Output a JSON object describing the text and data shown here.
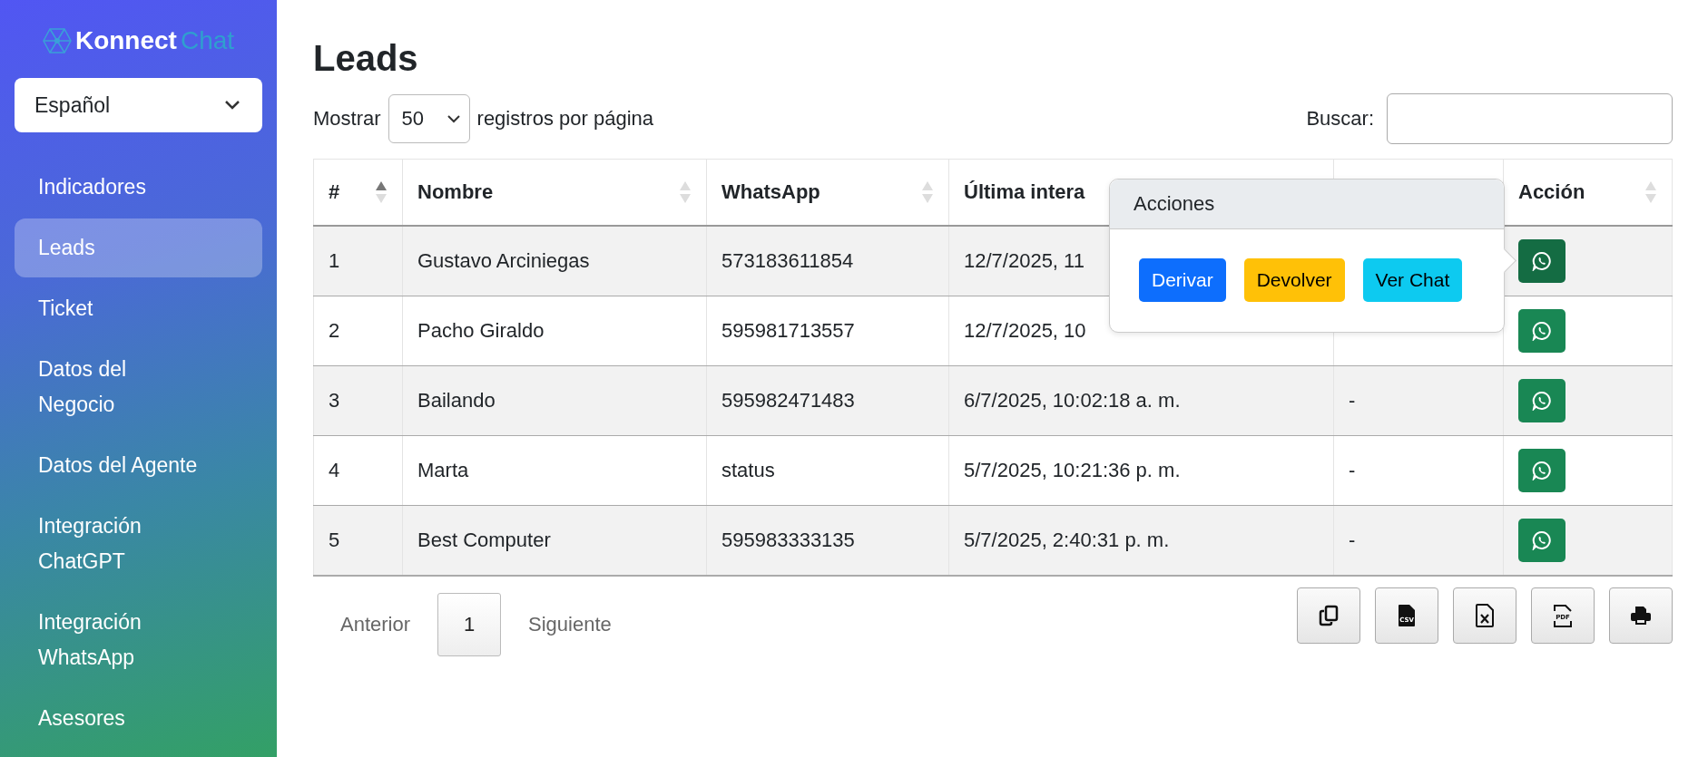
{
  "sidebar": {
    "logo": {
      "word_1": "Konnect",
      "word_2": "Chat"
    },
    "language": "Español",
    "items": [
      {
        "label": "Indicadores",
        "selected": false
      },
      {
        "label": "Leads",
        "selected": true
      },
      {
        "label": "Ticket",
        "selected": false
      },
      {
        "label": "Datos del Negocio",
        "selected": false
      },
      {
        "label": "Datos del Agente",
        "selected": false
      },
      {
        "label": "Integración ChatGPT",
        "selected": false
      },
      {
        "label": "Integración WhatsApp",
        "selected": false
      },
      {
        "label": "Asesores",
        "selected": false
      }
    ]
  },
  "page": {
    "title": "Leads",
    "length_prefix": "Mostrar",
    "length_value": "50",
    "length_suffix": "registros por página",
    "search_label": "Buscar:"
  },
  "table": {
    "columns": [
      {
        "label": "#",
        "sorted": true
      },
      {
        "label": "Nombre",
        "sorted": false
      },
      {
        "label": "WhatsApp",
        "sorted": false
      },
      {
        "label": "Última intera"
      },
      {},
      {
        "label": "Acción",
        "sorted": false
      }
    ],
    "rows": [
      {
        "cells": [
          "1",
          "Gustavo Arciniegas",
          "573183611854",
          "12/7/2025, 11",
          ""
        ],
        "active": true
      },
      {
        "cells": [
          "2",
          "Pacho Giraldo",
          "595981713557",
          "12/7/2025, 10",
          ""
        ],
        "active": false
      },
      {
        "cells": [
          "3",
          "Bailando",
          "595982471483",
          "6/7/2025, 10:02:18 a. m.",
          "-"
        ],
        "active": false
      },
      {
        "cells": [
          "4",
          "Marta",
          "status",
          "5/7/2025, 10:21:36 p. m.",
          "-"
        ],
        "active": false
      },
      {
        "cells": [
          "5",
          "Best Computer",
          "595983333135",
          "5/7/2025, 2:40:31 p. m.",
          "-"
        ],
        "active": false
      }
    ]
  },
  "popover": {
    "title": "Acciones",
    "buttons": [
      {
        "label": "Derivar",
        "kind": "primary"
      },
      {
        "label": "Devolver",
        "kind": "warning"
      },
      {
        "label": "Ver Chat",
        "kind": "info"
      }
    ]
  },
  "pagination": {
    "previous": "Anterior",
    "pages": [
      {
        "label": "1",
        "selected": true
      }
    ],
    "next": "Siguiente"
  },
  "export_buttons": [
    {
      "kind": "copy"
    },
    {
      "kind": "csv",
      "text": "CSV"
    },
    {
      "kind": "excel"
    },
    {
      "kind": "pdf",
      "text": "PDF"
    },
    {
      "kind": "print"
    }
  ]
}
